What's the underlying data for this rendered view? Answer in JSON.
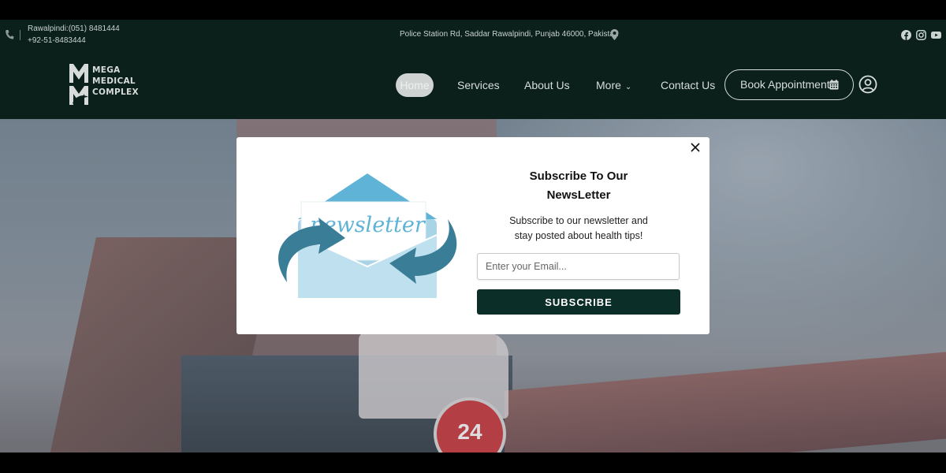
{
  "topbar": {
    "phone_line1": "Rawalpindi:(051) 8481444",
    "phone_line2": "+92-51-8483444",
    "address": "Police Station Rd, Saddar Rawalpindi, Punjab 46000, Pakistan",
    "social_icons": [
      "facebook-icon",
      "instagram-icon",
      "youtube-icon"
    ]
  },
  "brand": {
    "logo_text": "MEGA MEDICAL COMPLEX",
    "line1": "MEGA",
    "line2": "MEDICAL",
    "line3": "COMPLEX"
  },
  "nav": {
    "items": [
      {
        "label": "Home",
        "active": true
      },
      {
        "label": "Services"
      },
      {
        "label": "About Us"
      },
      {
        "label": "More",
        "has_dropdown": true
      },
      {
        "label": "Contact Us"
      }
    ],
    "book_button": "Book Appointment"
  },
  "hero": {
    "badge_text": "24"
  },
  "modal": {
    "illustration_text": "newsletter",
    "title_line1": "Subscribe To Our",
    "title_line2": "NewsLetter",
    "desc_line1": "Subscribe to our newsletter and",
    "desc_line2": "stay posted about health tips!",
    "email_placeholder": "Enter your Email...",
    "subscribe_label": "SUBSCRIBE"
  },
  "colors": {
    "header_bg": "#0b1f1b",
    "button_dark": "#0b2e28",
    "envelope_blue": "#5fb3d6",
    "arrow_teal": "#3a7d96"
  }
}
